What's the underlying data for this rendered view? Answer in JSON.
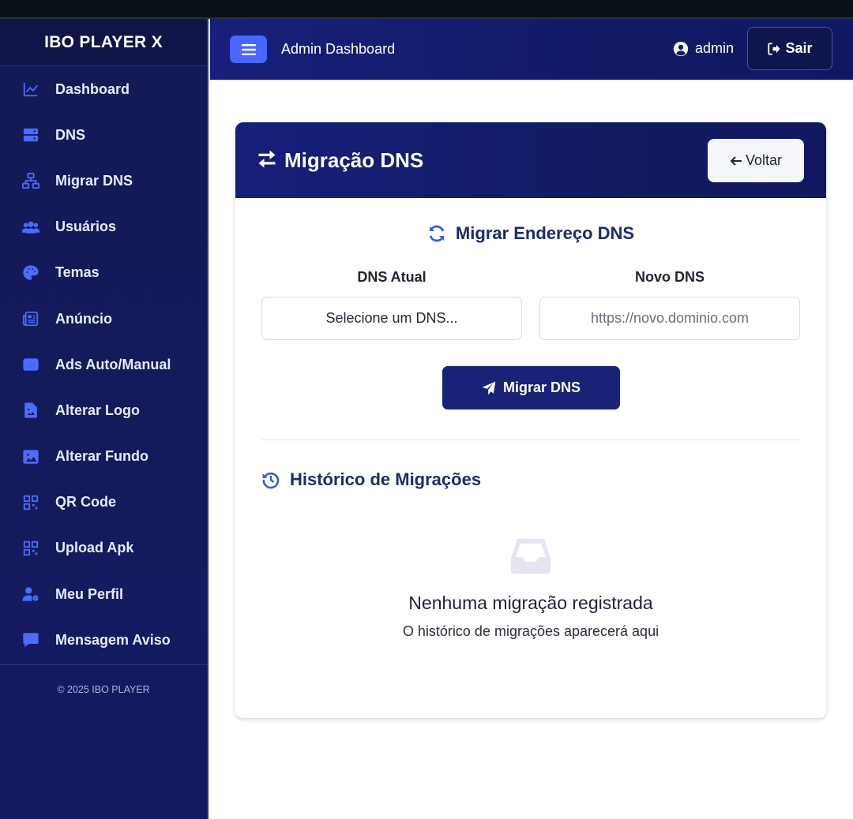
{
  "app": {
    "brand": "IBO PLAYER X",
    "copyright": "© 2025 IBO PLAYER"
  },
  "sidebar": {
    "items": [
      {
        "label": "Dashboard",
        "icon": "chart-line-icon"
      },
      {
        "label": "DNS",
        "icon": "server-icon"
      },
      {
        "label": "Migrar DNS",
        "icon": "network-icon"
      },
      {
        "label": "Usuários",
        "icon": "users-icon"
      },
      {
        "label": "Temas",
        "icon": "palette-icon"
      },
      {
        "label": "Anúncio",
        "icon": "newspaper-icon"
      },
      {
        "label": "Ads Auto/Manual",
        "icon": "ad-icon"
      },
      {
        "label": "Alterar Logo",
        "icon": "file-image-icon"
      },
      {
        "label": "Alterar Fundo",
        "icon": "image-icon"
      },
      {
        "label": "QR Code",
        "icon": "qrcode-icon"
      },
      {
        "label": "Upload Apk",
        "icon": "qrcode-icon"
      },
      {
        "label": "Meu Perfil",
        "icon": "user-gear-icon"
      },
      {
        "label": "Mensagem Aviso",
        "icon": "message-icon"
      }
    ]
  },
  "header": {
    "title": "Admin Dashboard",
    "user": "admin",
    "logout_label": "Sair"
  },
  "card": {
    "title": "Migração DNS",
    "back_label": "Voltar",
    "section_title": "Migrar Endereço DNS",
    "current_dns_label": "DNS Atual",
    "current_dns_value": "Selecione um DNS...",
    "new_dns_label": "Novo DNS",
    "new_dns_placeholder": "https://novo.dominio.com",
    "migrate_label": "Migrar DNS",
    "history_title": "Histórico de Migrações",
    "empty_title": "Nenhuma migração registrada",
    "empty_sub": "O histórico de migrações aparecerá aqui"
  },
  "colors": {
    "accent": "#4a66ff",
    "sidebar_bg": "#131a55",
    "primary_dark": "#1a2278",
    "heading": "#1e2a70"
  }
}
